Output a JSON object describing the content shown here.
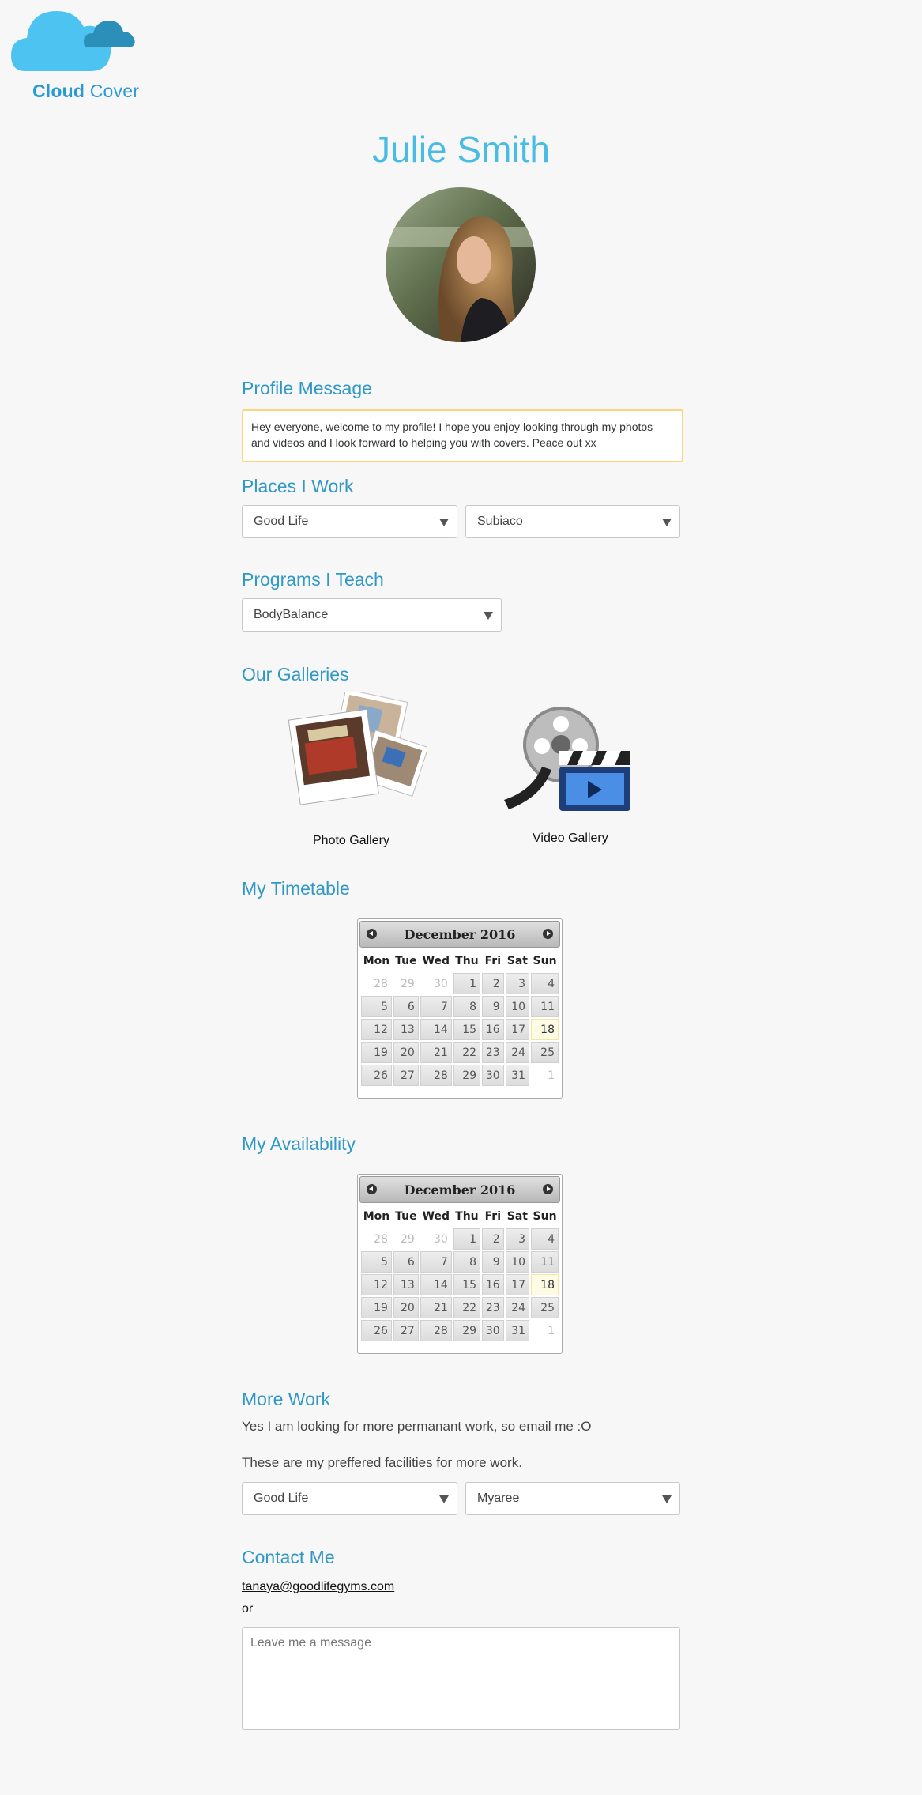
{
  "brand": {
    "name_part1": "Cloud",
    "name_part2": " Cover",
    "color": "#2a9ad2"
  },
  "profile": {
    "name": "Julie Smith"
  },
  "sections": {
    "profile_message": "Profile Message",
    "places": "Places I Work",
    "programs": "Programs I Teach",
    "galleries": "Our Galleries",
    "timetable": "My Timetable",
    "availability": "My Availability",
    "more_work": "More Work",
    "contact": "Contact Me"
  },
  "profile_message": "Hey everyone, welcome to my profile! I hope you enjoy looking through my photos and videos and I look forward to helping you with covers. Peace out xx",
  "places": {
    "gym": "Good Life",
    "location": "Subiaco"
  },
  "programs": {
    "selected": "BodyBalance"
  },
  "galleries": {
    "photo_label": "Photo Gallery",
    "video_label": "Video Gallery"
  },
  "calendar": {
    "title": "December 2016",
    "weekdays": [
      "Mon",
      "Tue",
      "Wed",
      "Thu",
      "Fri",
      "Sat",
      "Sun"
    ],
    "weeks": [
      [
        "28",
        "29",
        "30",
        "1",
        "2",
        "3",
        "4"
      ],
      [
        "5",
        "6",
        "7",
        "8",
        "9",
        "10",
        "11"
      ],
      [
        "12",
        "13",
        "14",
        "15",
        "16",
        "17",
        "18"
      ],
      [
        "19",
        "20",
        "21",
        "22",
        "23",
        "24",
        "25"
      ],
      [
        "26",
        "27",
        "28",
        "29",
        "30",
        "31",
        "1"
      ]
    ],
    "today": "18"
  },
  "more_work": {
    "line1": "Yes I am looking for more permanant work, so email me :O",
    "line2": "These are my preffered facilities for more work.",
    "gym": "Good Life",
    "location": "Myaree"
  },
  "contact": {
    "email": "tanaya@goodlifegyms.com",
    "or": "or",
    "message_placeholder": "Leave me a message"
  }
}
